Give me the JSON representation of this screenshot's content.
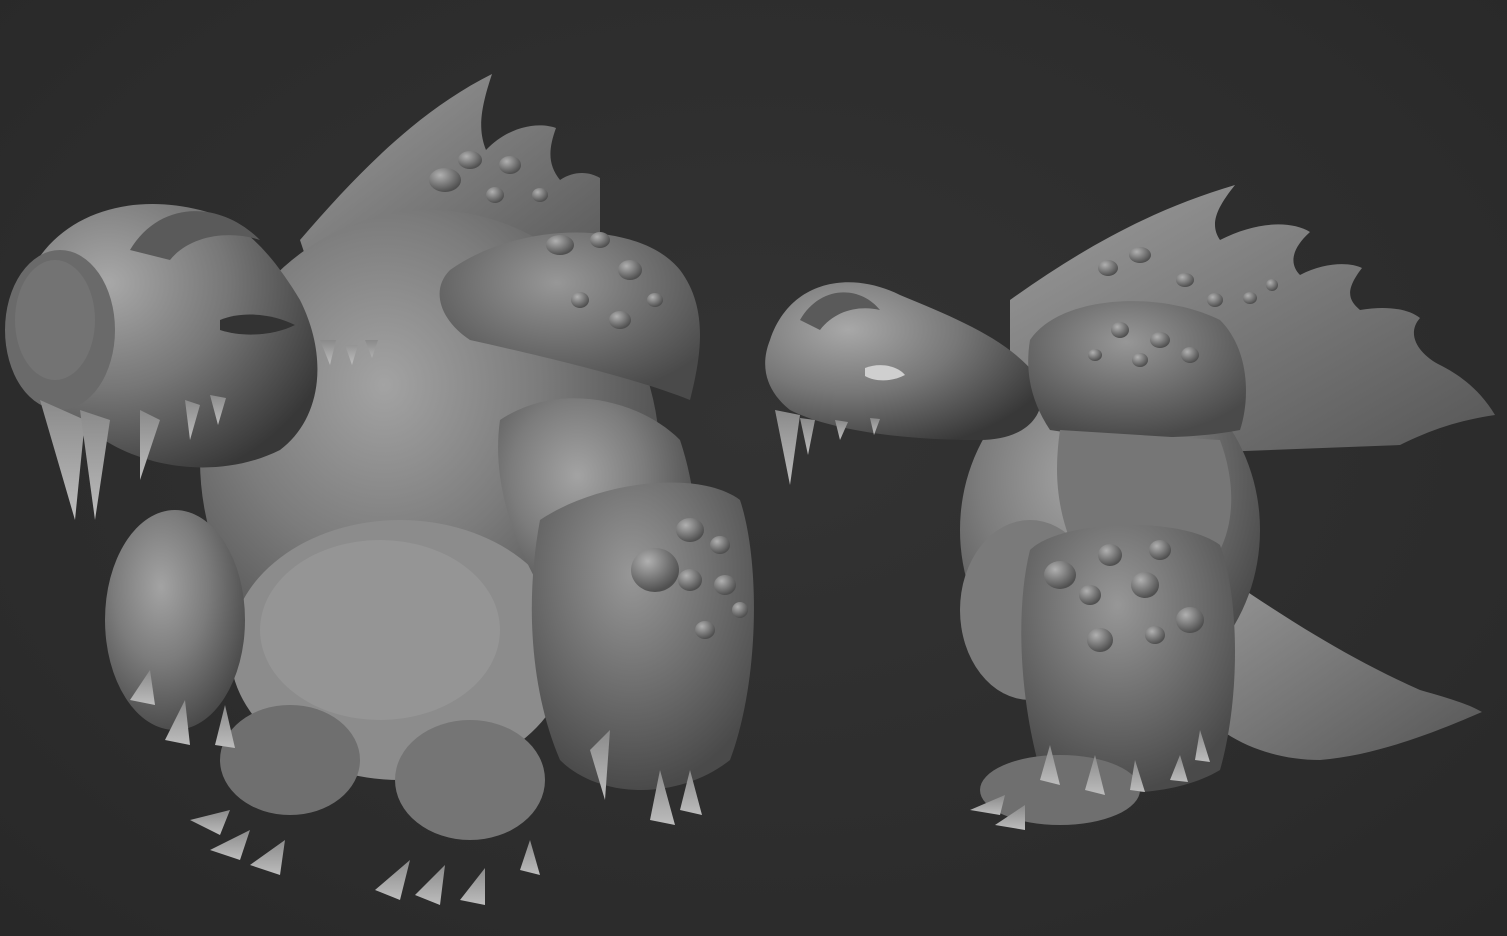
{
  "scene": {
    "background_color": "#2d2d2d",
    "clay_light": "#9a9a9a",
    "clay_mid": "#6e6e6e",
    "clay_dark": "#3a3a3a",
    "models": [
      {
        "name": "creature-front-three-quarter-view"
      },
      {
        "name": "creature-side-view"
      }
    ]
  }
}
